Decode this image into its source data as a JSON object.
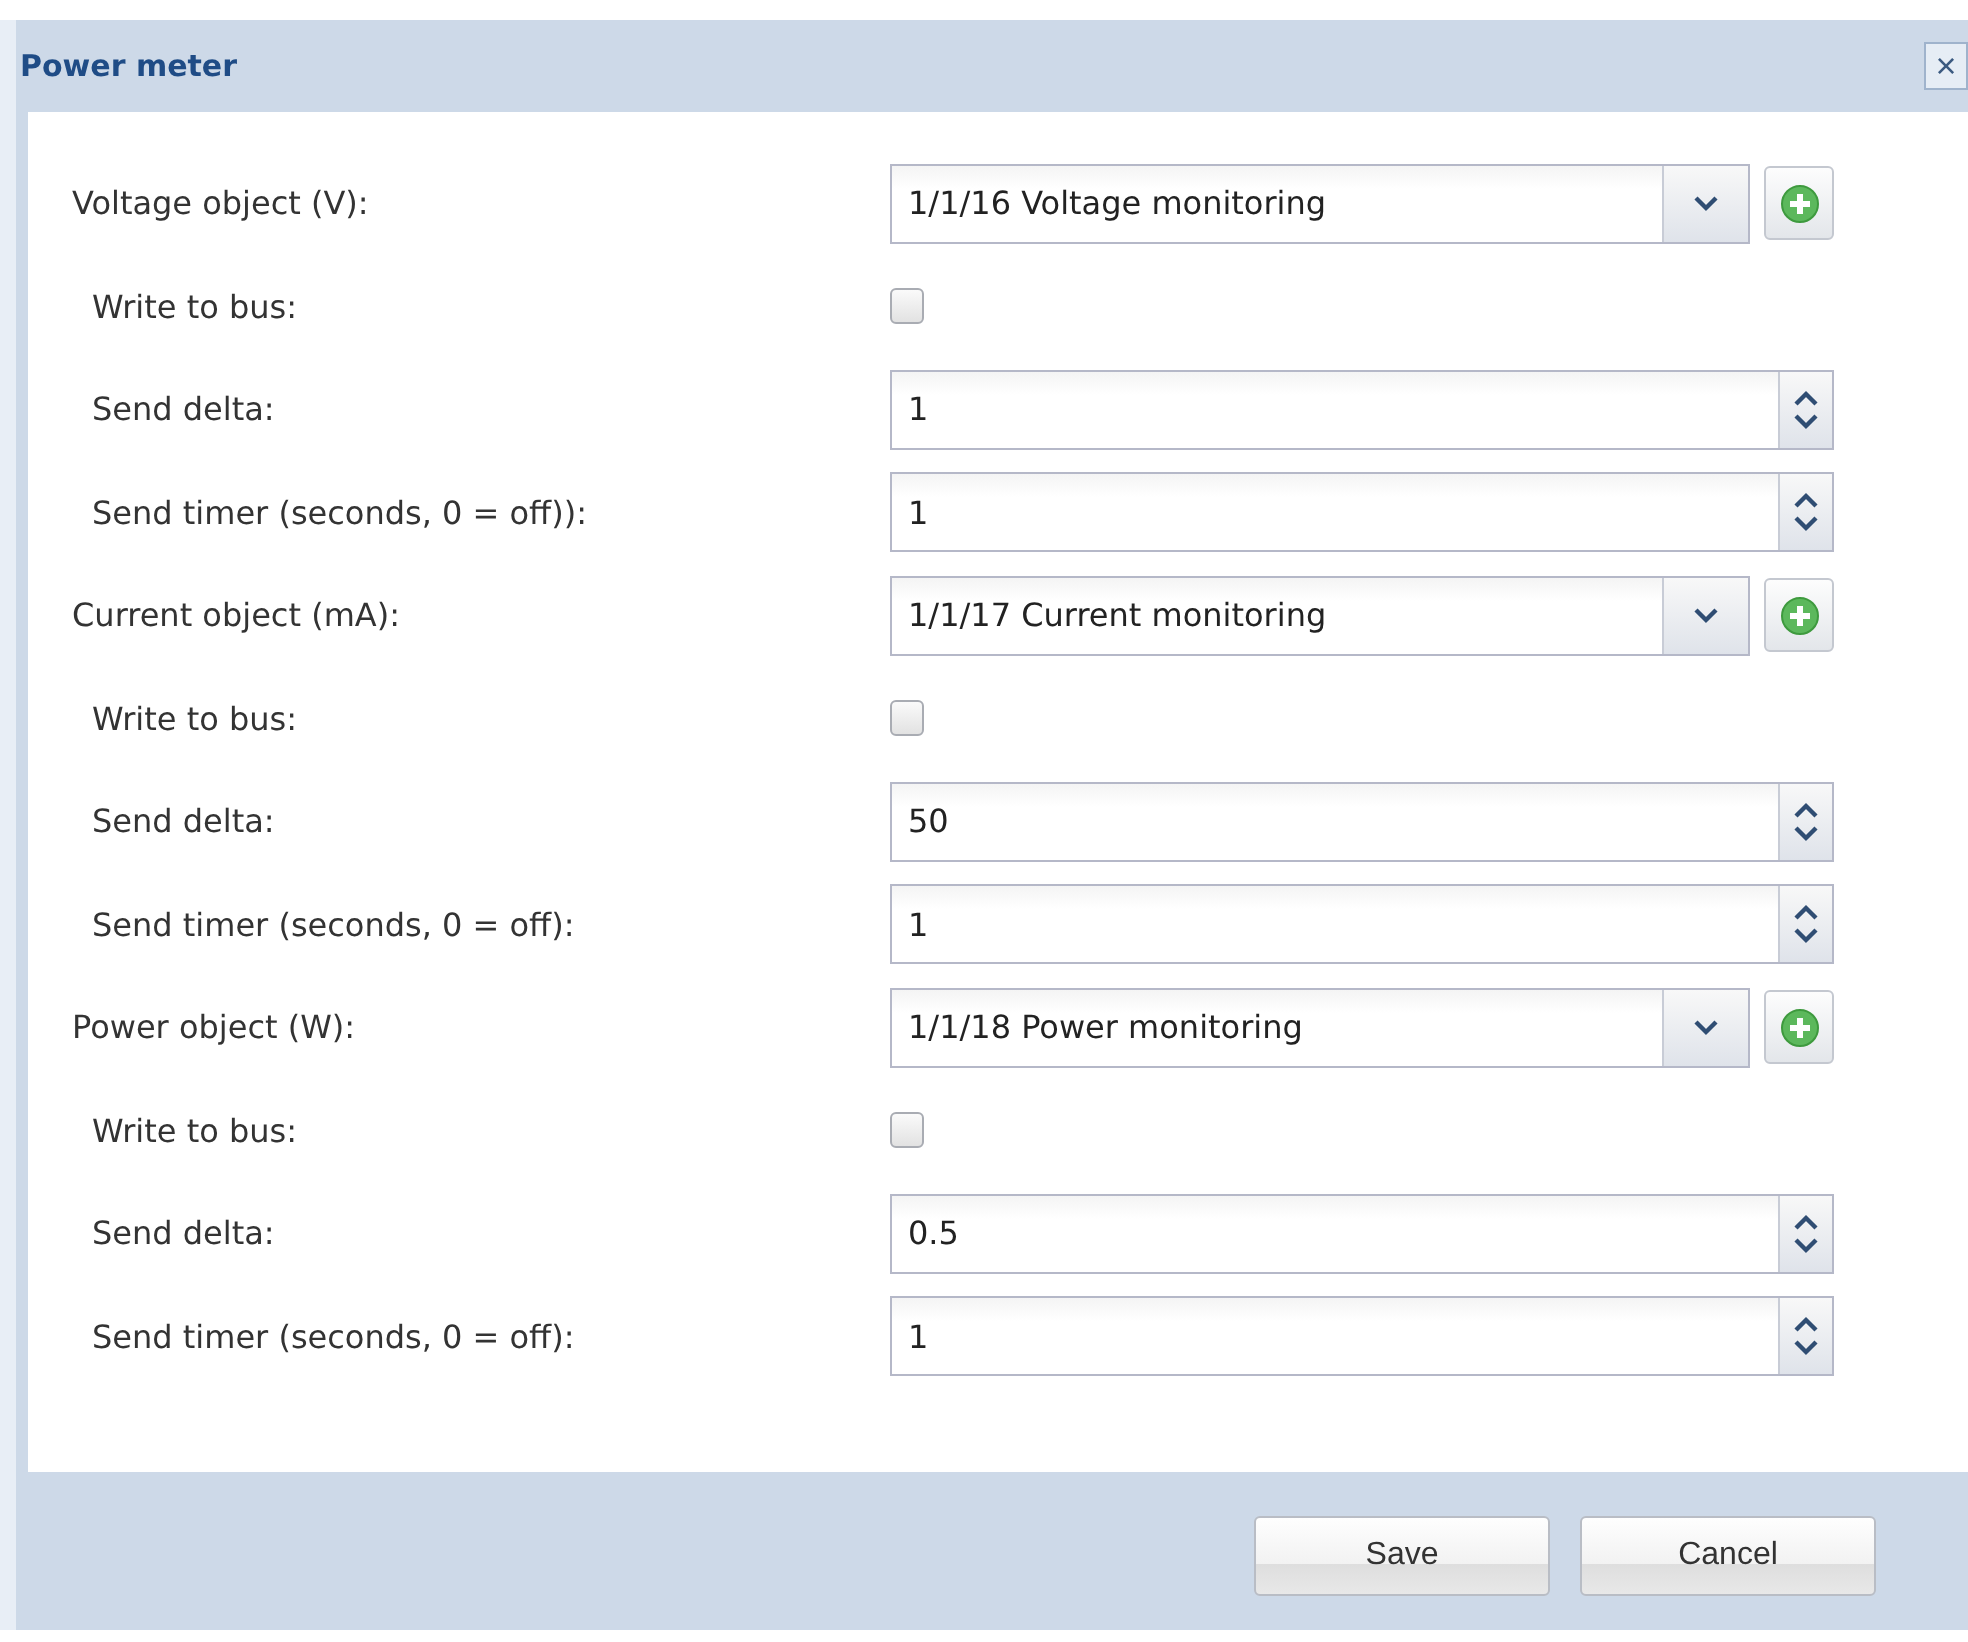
{
  "window": {
    "title": "Power meter",
    "close": "×"
  },
  "rows": [
    {
      "kind": "object",
      "label": "Voltage object (V):",
      "value": "1/1/16 Voltage monitoring"
    },
    {
      "kind": "checkbox",
      "label": "Write to bus:",
      "checked": false
    },
    {
      "kind": "spinner",
      "label": "Send delta:",
      "value": "1"
    },
    {
      "kind": "spinner",
      "label": "Send timer (seconds, 0 = off)):",
      "value": "1"
    },
    {
      "kind": "object",
      "label": "Current object (mA):",
      "value": "1/1/17 Current monitoring"
    },
    {
      "kind": "checkbox",
      "label": "Write to bus:",
      "checked": false
    },
    {
      "kind": "spinner",
      "label": "Send delta:",
      "value": "50"
    },
    {
      "kind": "spinner",
      "label": "Send timer (seconds, 0 = off):",
      "value": "1"
    },
    {
      "kind": "object",
      "label": "Power object (W):",
      "value": "1/1/18 Power monitoring"
    },
    {
      "kind": "checkbox",
      "label": "Write to bus:",
      "checked": false
    },
    {
      "kind": "spinner",
      "label": "Send delta:",
      "value": "0.5"
    },
    {
      "kind": "spinner",
      "label": "Send timer (seconds, 0 = off):",
      "value": "1"
    }
  ],
  "buttons": [
    "Save",
    "Cancel"
  ]
}
